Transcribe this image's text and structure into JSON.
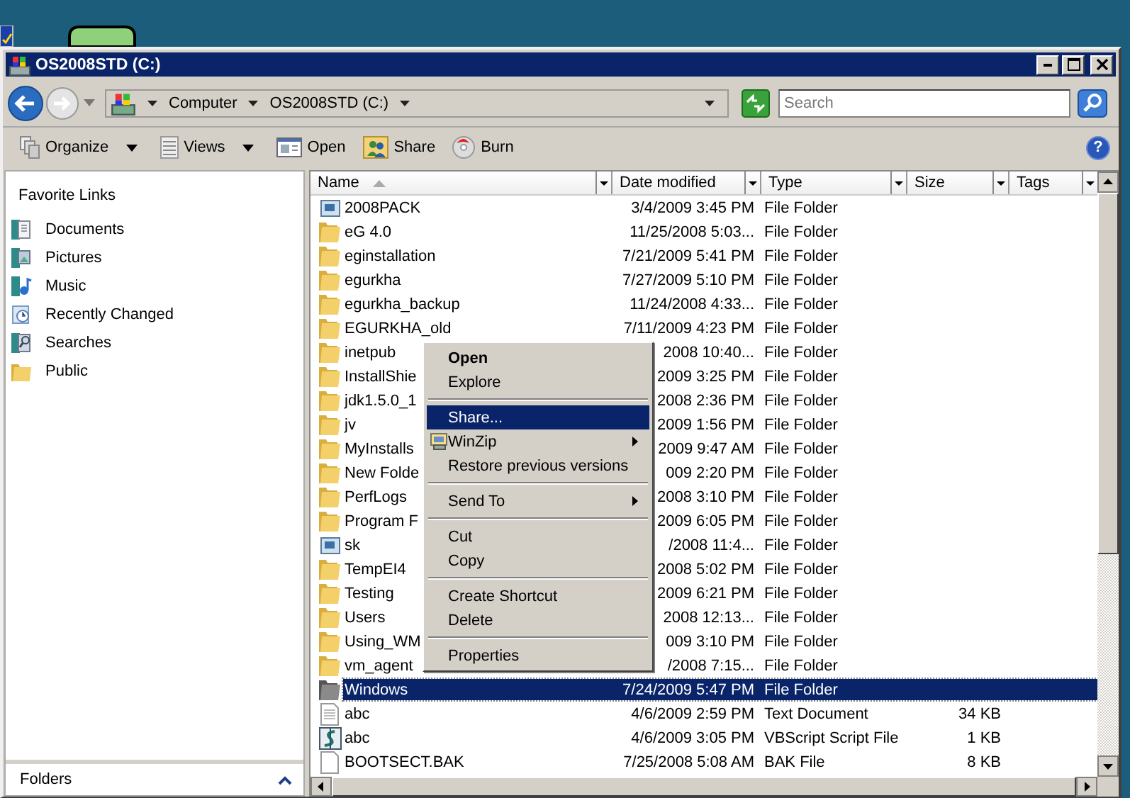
{
  "window": {
    "title": "OS2008STD (C:)"
  },
  "address": {
    "crumbs": [
      "Computer",
      "OS2008STD (C:)"
    ]
  },
  "search": {
    "placeholder": "Search"
  },
  "toolbar": [
    {
      "label": "Organize",
      "dropdown": true
    },
    {
      "label": "Views",
      "dropdown": true
    },
    {
      "label": "Open",
      "dropdown": false
    },
    {
      "label": "Share",
      "dropdown": false
    },
    {
      "label": "Burn",
      "dropdown": false
    }
  ],
  "help_button": {
    "label": "?"
  },
  "favorite_links": {
    "title": "Favorite Links",
    "items": [
      {
        "label": "Documents"
      },
      {
        "label": "Pictures"
      },
      {
        "label": "Music"
      },
      {
        "label": "Recently Changed"
      },
      {
        "label": "Searches"
      },
      {
        "label": "Public"
      }
    ]
  },
  "folders_bar": {
    "label": "Folders",
    "expanded": false
  },
  "table": {
    "columns": [
      {
        "label": "Name",
        "sorted": true
      },
      {
        "label": "Date modified",
        "sorted": false
      },
      {
        "label": "Type",
        "sorted": false
      },
      {
        "label": "Size",
        "sorted": false
      },
      {
        "label": "Tags",
        "sorted": false
      }
    ],
    "rows": [
      {
        "kind": "shortcut",
        "name": "2008PACK",
        "date": "3/4/2009 3:45 PM",
        "type": "File Folder",
        "selected": false
      },
      {
        "kind": "folder",
        "name": "eG 4.0",
        "date": "11/25/2008 5:03...",
        "type": "File Folder",
        "selected": false
      },
      {
        "kind": "folder",
        "name": "eginstallation",
        "date": "7/21/2009 5:41 PM",
        "type": "File Folder",
        "selected": false
      },
      {
        "kind": "folder",
        "name": "egurkha",
        "date": "7/27/2009 5:10 PM",
        "type": "File Folder",
        "selected": false
      },
      {
        "kind": "folder",
        "name": "egurkha_backup",
        "date": "11/24/2008 4:33...",
        "type": "File Folder",
        "selected": false
      },
      {
        "kind": "folder",
        "name": "EGURKHA_old",
        "date": "7/11/2009 4:23 PM",
        "type": "File Folder",
        "selected": false
      },
      {
        "kind": "folder",
        "name": "inetpub",
        "date": "2008 10:40...",
        "type": "File Folder",
        "selected": false
      },
      {
        "kind": "folder",
        "name": "InstallShie",
        "date": "2009 3:25 PM",
        "type": "File Folder",
        "selected": false
      },
      {
        "kind": "folder",
        "name": "jdk1.5.0_1",
        "date": "2008 2:36 PM",
        "type": "File Folder",
        "selected": false
      },
      {
        "kind": "folder",
        "name": "jv",
        "date": "2009 1:56 PM",
        "type": "File Folder",
        "selected": false
      },
      {
        "kind": "folder",
        "name": "MyInstalls",
        "date": "2009 9:47 AM",
        "type": "File Folder",
        "selected": false
      },
      {
        "kind": "folder",
        "name": "New Folde",
        "date": "009 2:20 PM",
        "type": "File Folder",
        "selected": false
      },
      {
        "kind": "folder",
        "name": "PerfLogs",
        "date": "2008 3:10 PM",
        "type": "File Folder",
        "selected": false
      },
      {
        "kind": "folder",
        "name": "Program F",
        "date": "2009 6:05 PM",
        "type": "File Folder",
        "selected": false
      },
      {
        "kind": "shortcut",
        "name": "sk",
        "date": "/2008 11:4...",
        "type": "File Folder",
        "selected": false
      },
      {
        "kind": "folder",
        "name": "TempEI4",
        "date": "2008 5:02 PM",
        "type": "File Folder",
        "selected": false
      },
      {
        "kind": "folder",
        "name": "Testing",
        "date": "2009 6:21 PM",
        "type": "File Folder",
        "selected": false
      },
      {
        "kind": "folder",
        "name": "Users",
        "date": "2008 12:13...",
        "type": "File Folder",
        "selected": false
      },
      {
        "kind": "folder",
        "name": "Using_WM",
        "date": "009 3:10 PM",
        "type": "File Folder",
        "selected": false
      },
      {
        "kind": "folder",
        "name": "vm_agent",
        "date": "/2008 7:15...",
        "type": "File Folder",
        "selected": false
      },
      {
        "kind": "system",
        "name": "Windows",
        "date": "7/24/2009 5:47 PM",
        "type": "File Folder",
        "selected": true
      },
      {
        "kind": "text",
        "name": "abc",
        "date": "4/6/2009 2:59 PM",
        "type": "Text Document",
        "size": "34 KB",
        "selected": false
      },
      {
        "kind": "script",
        "name": "abc",
        "date": "4/6/2009 3:05 PM",
        "type": "VBScript Script File",
        "size": "1 KB",
        "selected": false
      },
      {
        "kind": "file",
        "name": "BOOTSECT.BAK",
        "date": "7/25/2008 5:08 AM",
        "type": "BAK File",
        "size": "8 KB",
        "selected": false
      }
    ]
  },
  "context_menu": [
    {
      "kind": "item",
      "label": "Open",
      "default": true,
      "selected": false,
      "submenu": false
    },
    {
      "kind": "item",
      "label": "Explore",
      "default": false,
      "selected": false,
      "submenu": false
    },
    {
      "kind": "separator"
    },
    {
      "kind": "item",
      "label": "Share...",
      "default": false,
      "selected": true,
      "submenu": false
    },
    {
      "kind": "icon-item",
      "label": "WinZip",
      "default": false,
      "selected": false,
      "submenu": true
    },
    {
      "kind": "item",
      "label": "Restore previous versions",
      "default": false,
      "selected": false,
      "submenu": false
    },
    {
      "kind": "separator"
    },
    {
      "kind": "item",
      "label": "Send To",
      "default": false,
      "selected": false,
      "submenu": true
    },
    {
      "kind": "separator"
    },
    {
      "kind": "item",
      "label": "Cut",
      "default": false,
      "selected": false,
      "submenu": false
    },
    {
      "kind": "item",
      "label": "Copy",
      "default": false,
      "selected": false,
      "submenu": false
    },
    {
      "kind": "separator"
    },
    {
      "kind": "item",
      "label": "Create Shortcut",
      "default": false,
      "selected": false,
      "submenu": false
    },
    {
      "kind": "item",
      "label": "Delete",
      "default": false,
      "selected": false,
      "submenu": false
    },
    {
      "kind": "separator"
    },
    {
      "kind": "item",
      "label": "Properties",
      "default": false,
      "selected": false,
      "submenu": false
    }
  ]
}
